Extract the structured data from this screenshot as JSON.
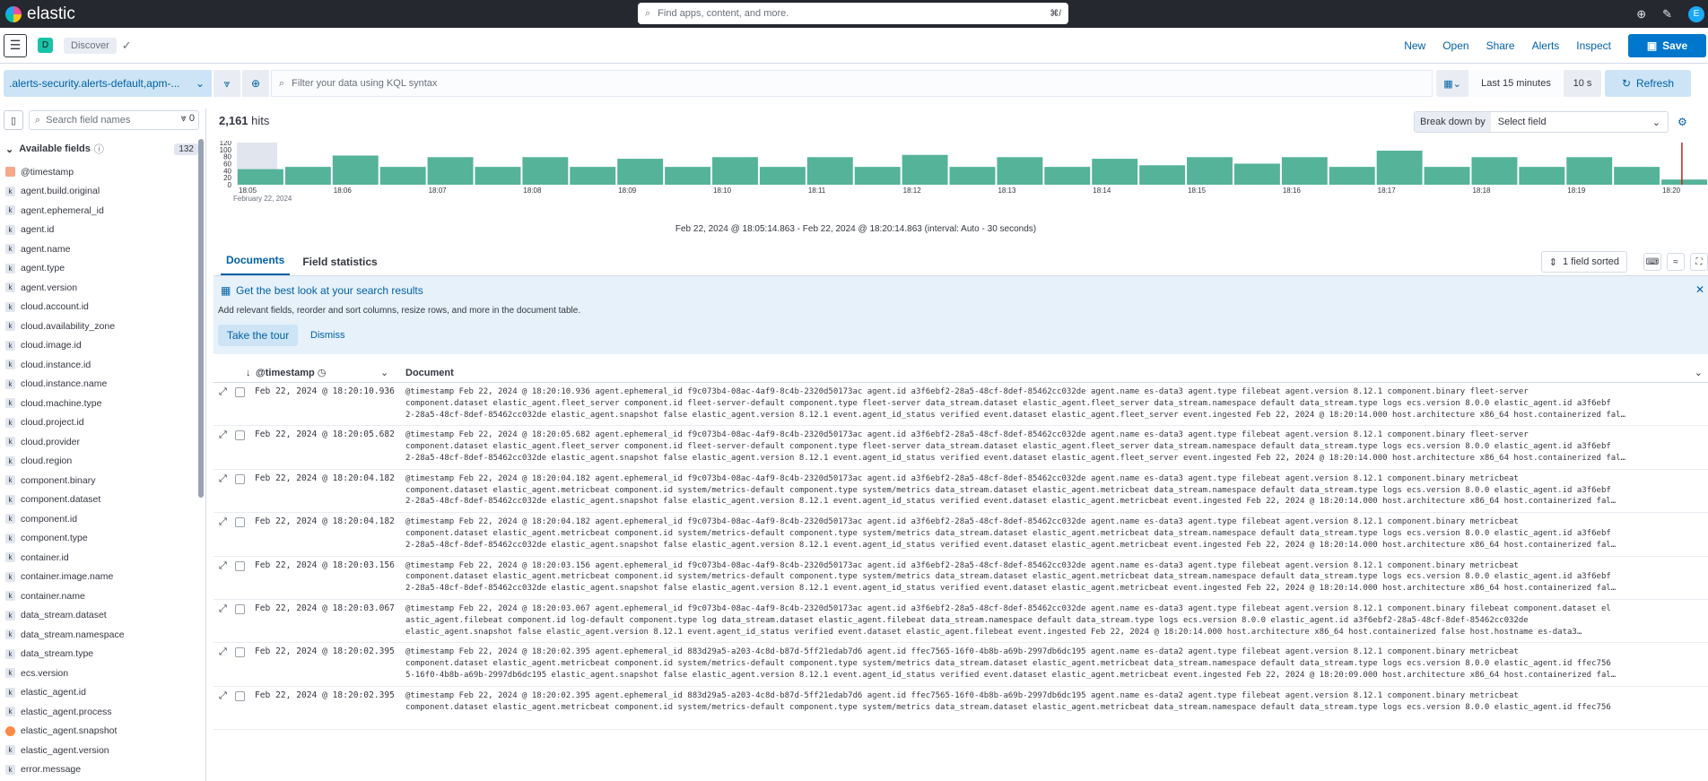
{
  "topbar": {
    "brand": "elastic",
    "search_placeholder": "Find apps, content, and more.",
    "search_shortcut": "⌘/",
    "avatar": "E"
  },
  "header": {
    "space_initial": "D",
    "breadcrumb": "Discover",
    "links": [
      "New",
      "Open",
      "Share",
      "Alerts",
      "Inspect"
    ],
    "save_label": "Save"
  },
  "query": {
    "data_view": ".alerts-security.alerts-default,apm-...",
    "placeholder": "Filter your data using KQL syntax",
    "time_range": "Last 15 minutes",
    "interval": "10 s",
    "refresh": "Refresh"
  },
  "sidebar": {
    "search_placeholder": "Search field names",
    "filter_count": "0",
    "available_label": "Available fields",
    "available_count": "132",
    "fields": [
      {
        "name": "@timestamp",
        "type": "date"
      },
      {
        "name": "agent.build.original",
        "type": "k"
      },
      {
        "name": "agent.ephemeral_id",
        "type": "k"
      },
      {
        "name": "agent.id",
        "type": "k"
      },
      {
        "name": "agent.name",
        "type": "k"
      },
      {
        "name": "agent.type",
        "type": "k"
      },
      {
        "name": "agent.version",
        "type": "k"
      },
      {
        "name": "cloud.account.id",
        "type": "k"
      },
      {
        "name": "cloud.availability_zone",
        "type": "k"
      },
      {
        "name": "cloud.image.id",
        "type": "k"
      },
      {
        "name": "cloud.instance.id",
        "type": "k"
      },
      {
        "name": "cloud.instance.name",
        "type": "k"
      },
      {
        "name": "cloud.machine.type",
        "type": "k"
      },
      {
        "name": "cloud.project.id",
        "type": "k"
      },
      {
        "name": "cloud.provider",
        "type": "k"
      },
      {
        "name": "cloud.region",
        "type": "k"
      },
      {
        "name": "component.binary",
        "type": "k"
      },
      {
        "name": "component.dataset",
        "type": "k"
      },
      {
        "name": "component.id",
        "type": "k"
      },
      {
        "name": "component.type",
        "type": "k"
      },
      {
        "name": "container.id",
        "type": "k"
      },
      {
        "name": "container.image.name",
        "type": "k"
      },
      {
        "name": "container.name",
        "type": "k"
      },
      {
        "name": "data_stream.dataset",
        "type": "k"
      },
      {
        "name": "data_stream.namespace",
        "type": "k"
      },
      {
        "name": "data_stream.type",
        "type": "k"
      },
      {
        "name": "ecs.version",
        "type": "k"
      },
      {
        "name": "elastic_agent.id",
        "type": "k"
      },
      {
        "name": "elastic_agent.process",
        "type": "k"
      },
      {
        "name": "elastic_agent.snapshot",
        "type": "bool"
      },
      {
        "name": "elastic_agent.version",
        "type": "k"
      },
      {
        "name": "error.message",
        "type": "k"
      }
    ]
  },
  "main": {
    "hits_count": "2,161",
    "hits_label": "hits",
    "breakdown_label": "Break down by",
    "breakdown_placeholder": "Select field",
    "chart_caption": "Feb 22, 2024 @ 18:05:14.863 - Feb 22, 2024 @ 18:20:14.863 (interval: Auto - 30 seconds)",
    "tabs": [
      "Documents",
      "Field statistics"
    ],
    "sorted_label": "1 field sorted",
    "callout_title": "Get the best look at your search results",
    "callout_desc": "Add relevant fields, reorder and sort columns, resize rows, and more in the document table.",
    "tour_label": "Take the tour",
    "dismiss_label": "Dismiss",
    "col_timestamp": "@timestamp",
    "col_document": "Document"
  },
  "chart_data": {
    "type": "bar",
    "y_ticks": [
      "120",
      "100",
      "80",
      "60",
      "40",
      "20",
      "0"
    ],
    "x_ticks": [
      "18:05",
      "18:06",
      "18:07",
      "18:08",
      "18:09",
      "18:10",
      "18:11",
      "18:12",
      "18:13",
      "18:14",
      "18:15",
      "18:16",
      "18:17",
      "18:18",
      "18:19",
      "18:20"
    ],
    "x_date": "February 22, 2024",
    "ylim": [
      0,
      130
    ],
    "values": [
      48,
      55,
      90,
      55,
      85,
      55,
      85,
      55,
      80,
      55,
      85,
      55,
      85,
      55,
      92,
      55,
      85,
      55,
      80,
      60,
      85,
      65,
      85,
      55,
      105,
      55,
      85,
      55,
      85,
      55,
      16
    ],
    "color": "#54b399"
  },
  "rows": [
    {
      "ts": "Feb 22, 2024 @ 18:20:10.936",
      "line1": "@timestamp Feb 22, 2024 @ 18:20:10.936 agent.ephemeral_id f9c073b4-08ac-4af9-8c4b-2320d50173ac agent.id a3f6ebf2-28a5-48cf-8def-85462cc032de agent.name es-data3 agent.type filebeat agent.version 8.12.1 component.binary fleet-server",
      "line2": "component.dataset elastic_agent.fleet_server component.id fleet-server-default component.type fleet-server data_stream.dataset elastic_agent.fleet_server data_stream.namespace default data_stream.type logs ecs.version 8.0.0 elastic_agent.id a3f6ebf",
      "line3": "2-28a5-48cf-8def-85462cc032de elastic_agent.snapshot false elastic_agent.version 8.12.1 event.agent_id_status verified event.dataset elastic_agent.fleet_server event.ingested Feb 22, 2024 @ 18:20:14.000 host.architecture x86_64 host.containerized fal…"
    },
    {
      "ts": "Feb 22, 2024 @ 18:20:05.682",
      "line1": "@timestamp Feb 22, 2024 @ 18:20:05.682 agent.ephemeral_id f9c073b4-08ac-4af9-8c4b-2320d50173ac agent.id a3f6ebf2-28a5-48cf-8def-85462cc032de agent.name es-data3 agent.type filebeat agent.version 8.12.1 component.binary fleet-server",
      "line2": "component.dataset elastic_agent.fleet_server component.id fleet-server-default component.type fleet-server data_stream.dataset elastic_agent.fleet_server data_stream.namespace default data_stream.type logs ecs.version 8.0.0 elastic_agent.id a3f6ebf",
      "line3": "2-28a5-48cf-8def-85462cc032de elastic_agent.snapshot false elastic_agent.version 8.12.1 event.agent_id_status verified event.dataset elastic_agent.fleet_server event.ingested Feb 22, 2024 @ 18:20:14.000 host.architecture x86_64 host.containerized fal…"
    },
    {
      "ts": "Feb 22, 2024 @ 18:20:04.182",
      "line1": "@timestamp Feb 22, 2024 @ 18:20:04.182 agent.ephemeral_id f9c073b4-08ac-4af9-8c4b-2320d50173ac agent.id a3f6ebf2-28a5-48cf-8def-85462cc032de agent.name es-data3 agent.type filebeat agent.version 8.12.1 component.binary metricbeat",
      "line2": "component.dataset elastic_agent.metricbeat component.id system/metrics-default component.type system/metrics data_stream.dataset elastic_agent.metricbeat data_stream.namespace default data_stream.type logs ecs.version 8.0.0 elastic_agent.id a3f6ebf",
      "line3": "2-28a5-48cf-8def-85462cc032de elastic_agent.snapshot false elastic_agent.version 8.12.1 event.agent_id_status verified event.dataset elastic_agent.metricbeat event.ingested Feb 22, 2024 @ 18:20:14.000 host.architecture x86_64 host.containerized fal…"
    },
    {
      "ts": "Feb 22, 2024 @ 18:20:04.182",
      "line1": "@timestamp Feb 22, 2024 @ 18:20:04.182 agent.ephemeral_id f9c073b4-08ac-4af9-8c4b-2320d50173ac agent.id a3f6ebf2-28a5-48cf-8def-85462cc032de agent.name es-data3 agent.type filebeat agent.version 8.12.1 component.binary metricbeat",
      "line2": "component.dataset elastic_agent.metricbeat component.id system/metrics-default component.type system/metrics data_stream.dataset elastic_agent.metricbeat data_stream.namespace default data_stream.type logs ecs.version 8.0.0 elastic_agent.id a3f6ebf",
      "line3": "2-28a5-48cf-8def-85462cc032de elastic_agent.snapshot false elastic_agent.version 8.12.1 event.agent_id_status verified event.dataset elastic_agent.metricbeat event.ingested Feb 22, 2024 @ 18:20:14.000 host.architecture x86_64 host.containerized fal…"
    },
    {
      "ts": "Feb 22, 2024 @ 18:20:03.156",
      "line1": "@timestamp Feb 22, 2024 @ 18:20:03.156 agent.ephemeral_id f9c073b4-08ac-4af9-8c4b-2320d50173ac agent.id a3f6ebf2-28a5-48cf-8def-85462cc032de agent.name es-data3 agent.type filebeat agent.version 8.12.1 component.binary metricbeat",
      "line2": "component.dataset elastic_agent.metricbeat component.id system/metrics-default component.type system/metrics data_stream.dataset elastic_agent.metricbeat data_stream.namespace default data_stream.type logs ecs.version 8.0.0 elastic_agent.id a3f6ebf",
      "line3": "2-28a5-48cf-8def-85462cc032de elastic_agent.snapshot false elastic_agent.version 8.12.1 event.agent_id_status verified event.dataset elastic_agent.metricbeat event.ingested Feb 22, 2024 @ 18:20:14.000 host.architecture x86_64 host.containerized fal…"
    },
    {
      "ts": "Feb 22, 2024 @ 18:20:03.067",
      "line1": "@timestamp Feb 22, 2024 @ 18:20:03.067 agent.ephemeral_id f9c073b4-08ac-4af9-8c4b-2320d50173ac agent.id a3f6ebf2-28a5-48cf-8def-85462cc032de agent.name es-data3 agent.type filebeat agent.version 8.12.1 component.binary filebeat component.dataset el",
      "line2": "astic_agent.filebeat component.id log-default component.type log data_stream.dataset elastic_agent.filebeat data_stream.namespace default data_stream.type logs ecs.version 8.0.0 elastic_agent.id a3f6ebf2-28a5-48cf-8def-85462cc032de",
      "line3": "elastic_agent.snapshot false elastic_agent.version 8.12.1 event.agent_id_status verified event.dataset elastic_agent.filebeat event.ingested Feb 22, 2024 @ 18:20:14.000 host.architecture x86_64 host.containerized false host.hostname es-data3…"
    },
    {
      "ts": "Feb 22, 2024 @ 18:20:02.395",
      "line1": "@timestamp Feb 22, 2024 @ 18:20:02.395 agent.ephemeral_id 883d29a5-a203-4c8d-b87d-5ff21edab7d6 agent.id ffec7565-16f0-4b8b-a69b-2997db6dc195 agent.name es-data2 agent.type filebeat agent.version 8.12.1 component.binary metricbeat",
      "line2": "component.dataset elastic_agent.metricbeat component.id system/metrics-default component.type system/metrics data_stream.dataset elastic_agent.metricbeat data_stream.namespace default data_stream.type logs ecs.version 8.0.0 elastic_agent.id ffec756",
      "line3": "5-16f0-4b8b-a69b-2997db6dc195 elastic_agent.snapshot false elastic_agent.version 8.12.1 event.agent_id_status verified event.dataset elastic_agent.metricbeat event.ingested Feb 22, 2024 @ 18:20:09.000 host.architecture x86_64 host.containerized fal…"
    },
    {
      "ts": "Feb 22, 2024 @ 18:20:02.395",
      "line1": "@timestamp Feb 22, 2024 @ 18:20:02.395 agent.ephemeral_id 883d29a5-a203-4c8d-b87d-5ff21edab7d6 agent.id ffec7565-16f0-4b8b-a69b-2997db6dc195 agent.name es-data2 agent.type filebeat agent.version 8.12.1 component.binary metricbeat",
      "line2": "component.dataset elastic_agent.metricbeat component.id system/metrics-default component.type system/metrics data_stream.dataset elastic_agent.metricbeat data_stream.namespace default data_stream.type logs ecs.version 8.0.0 elastic_agent.id ffec756",
      "line3": ""
    }
  ]
}
